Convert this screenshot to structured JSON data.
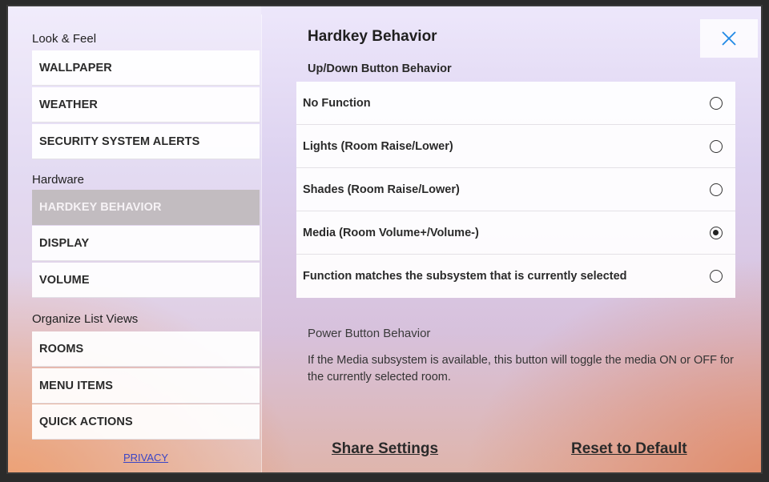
{
  "sidebar": {
    "sections": [
      {
        "label": "Look & Feel",
        "items": [
          "WALLPAPER",
          "WEATHER",
          "SECURITY SYSTEM ALERTS"
        ]
      },
      {
        "label": "Hardware",
        "items": [
          "HARDKEY BEHAVIOR",
          "DISPLAY",
          "VOLUME"
        ]
      },
      {
        "label": "Organize List Views",
        "items": [
          "ROOMS",
          "MENU ITEMS",
          "QUICK ACTIONS"
        ]
      }
    ],
    "selected_item": "HARDKEY BEHAVIOR",
    "privacy_label": "PRIVACY"
  },
  "main": {
    "title": "Hardkey Behavior",
    "updown_heading": "Up/Down Button Behavior",
    "options": [
      {
        "label": "No Function",
        "selected": false
      },
      {
        "label": "Lights (Room Raise/Lower)",
        "selected": false
      },
      {
        "label": "Shades (Room Raise/Lower)",
        "selected": false
      },
      {
        "label": "Media (Room Volume+/Volume-)",
        "selected": true
      },
      {
        "label": "Function matches the subsystem that is currently selected",
        "selected": false
      }
    ],
    "power_heading": "Power Button Behavior",
    "power_description": "If the Media subsystem is available, this button will toggle the media ON or OFF for the currently selected room.",
    "share_settings_label": "Share Settings",
    "reset_default_label": "Reset to Default",
    "close_icon": "close-icon"
  },
  "colors": {
    "accent": "#1e88e5",
    "link": "#3b45c6",
    "selected_item_bg": "#c2bcc0"
  }
}
